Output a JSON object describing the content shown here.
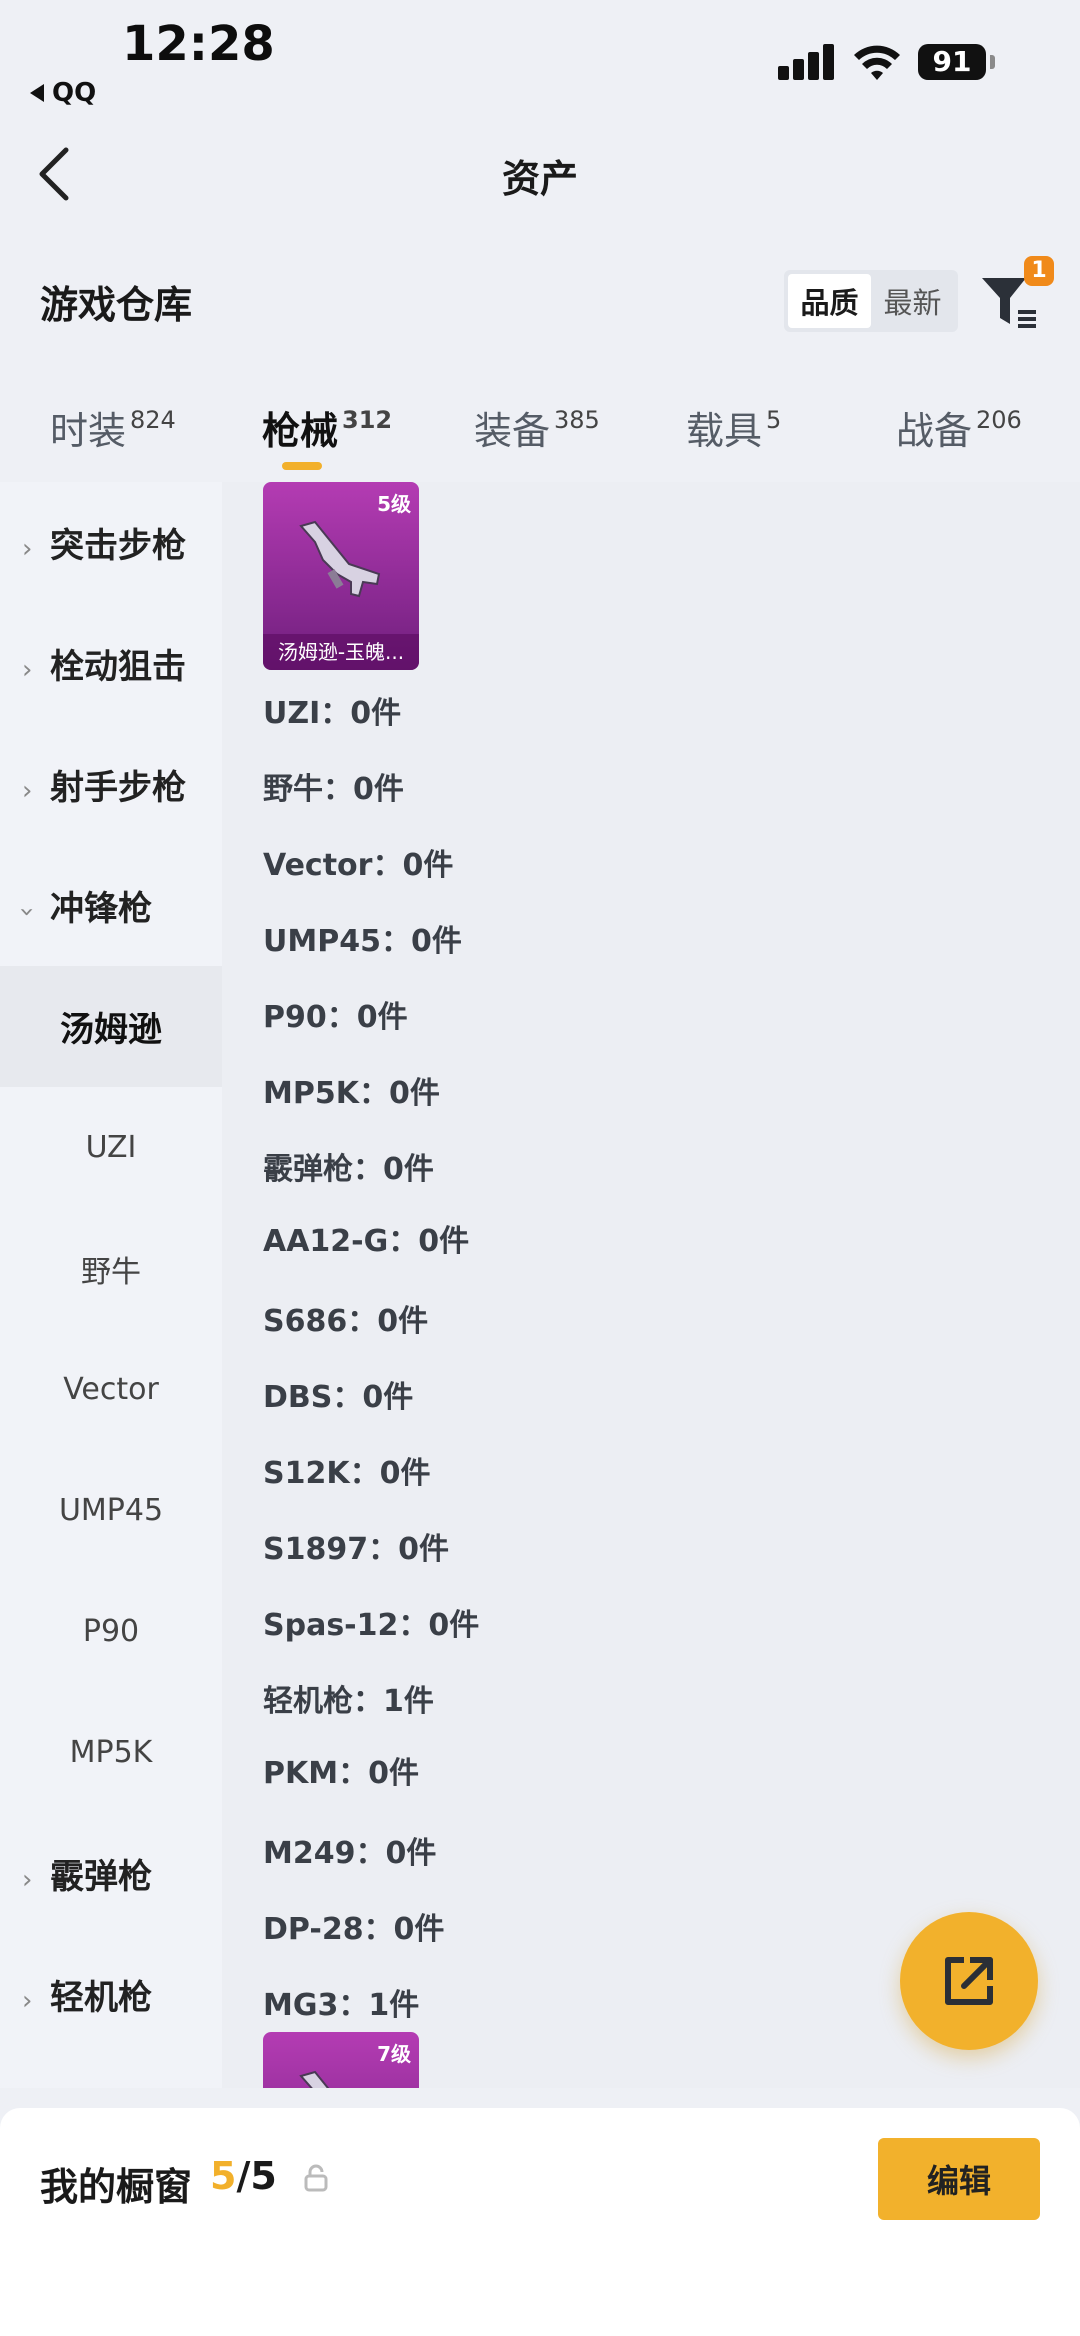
{
  "status_bar": {
    "time": "12:28",
    "back_app": "QQ",
    "battery": "91"
  },
  "header": {
    "title": "资产",
    "back_icon": "chevron-left-icon"
  },
  "section": {
    "title": "游戏仓库",
    "sort_options": [
      "品质",
      "最新"
    ],
    "sort_selected": "品质",
    "filter_badge": "1"
  },
  "tabs": [
    {
      "label": "时装",
      "count": "824"
    },
    {
      "label": "枪械",
      "count": "312",
      "active": true
    },
    {
      "label": "装备",
      "count": "385"
    },
    {
      "label": "载具",
      "count": "5"
    },
    {
      "label": "战备",
      "count": "206"
    }
  ],
  "sidebar": [
    {
      "label": "突击步枪",
      "type": "group",
      "expanded": false
    },
    {
      "label": "栓动狙击",
      "type": "group",
      "expanded": false
    },
    {
      "label": "射手步枪",
      "type": "group",
      "expanded": false
    },
    {
      "label": "冲锋枪",
      "type": "group",
      "expanded": true
    },
    {
      "label": "汤姆逊",
      "type": "sub",
      "selected": true
    },
    {
      "label": "UZI",
      "type": "sub"
    },
    {
      "label": "野牛",
      "type": "sub"
    },
    {
      "label": "Vector",
      "type": "sub"
    },
    {
      "label": "UMP45",
      "type": "sub"
    },
    {
      "label": "P90",
      "type": "sub"
    },
    {
      "label": "MP5K",
      "type": "sub"
    },
    {
      "label": "霰弹枪",
      "type": "group",
      "expanded": false
    },
    {
      "label": "轻机枪",
      "type": "group",
      "expanded": false
    }
  ],
  "content": {
    "cards": [
      {
        "level": "5级",
        "name": "汤姆逊-玉魄..."
      },
      {
        "level": "7级",
        "name": ""
      }
    ],
    "rows": [
      "UZI：0件",
      "野牛：0件",
      "Vector：0件",
      "UMP45：0件",
      "P90：0件",
      "MP5K：0件",
      "霰弹枪：0件",
      "AA12-G：0件",
      "S686：0件",
      "DBS：0件",
      "S12K：0件",
      "S1897：0件",
      "Spas-12：0件",
      "轻机枪：1件",
      "PKM：0件",
      "M249：0件",
      "DP-28：0件",
      "MG3：1件"
    ]
  },
  "bottom_bar": {
    "label": "我的橱窗",
    "current": "5",
    "total": "/5",
    "edit_label": "编辑"
  },
  "colors": {
    "accent": "#f2b12c",
    "card_purple": "#a33aa8",
    "badge": "#f08a1a"
  }
}
